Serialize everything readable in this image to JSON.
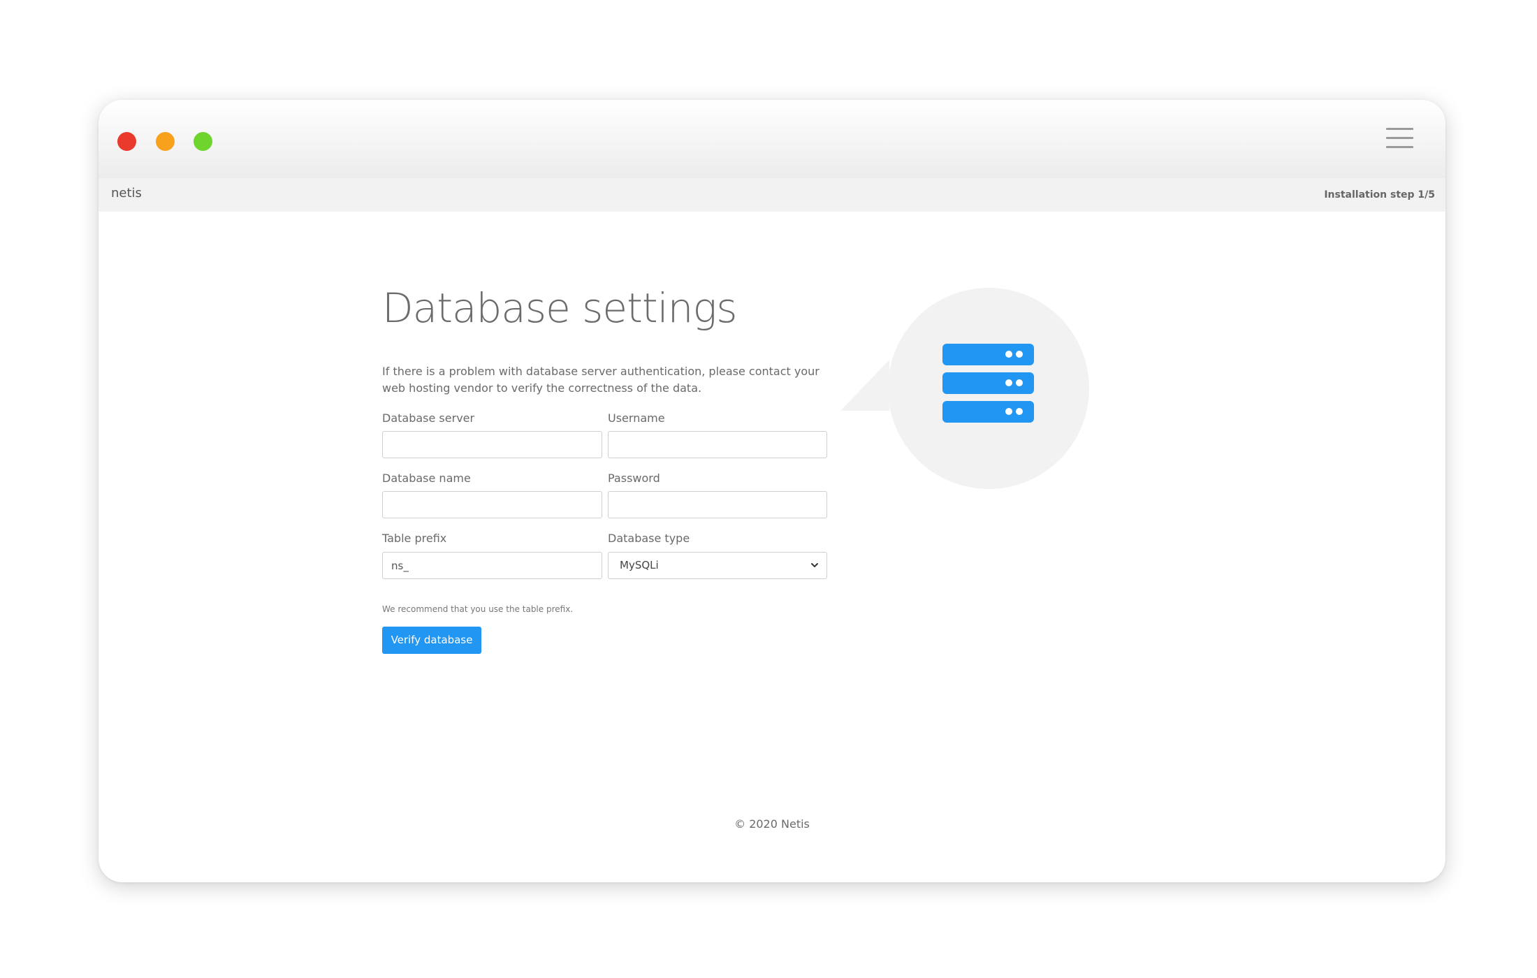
{
  "app": {
    "brand": "netis",
    "step": "Installation step 1/5"
  },
  "page": {
    "title": "Database settings",
    "description": "If there is a problem with database server authentication, please contact your web hosting vendor to verify the correctness of the data."
  },
  "form": {
    "db_server": {
      "label": "Database server",
      "value": ""
    },
    "username": {
      "label": "Username",
      "value": ""
    },
    "db_name": {
      "label": "Database name",
      "value": ""
    },
    "password": {
      "label": "Password",
      "value": ""
    },
    "table_prefix": {
      "label": "Table prefix",
      "value": "ns_",
      "hint": "We recommend that you use the table prefix."
    },
    "db_type": {
      "label": "Database type",
      "selected": "MySQLi"
    },
    "verify_label": "Verify database"
  },
  "footer": {
    "text": "© 2020 Netis"
  },
  "colors": {
    "accent": "#2196f3",
    "close": "#ea3a2e",
    "minimize": "#f8a11d",
    "maximize": "#6fd42d",
    "illustration_bg": "#f2f2f2"
  },
  "icons": {
    "menu": "hamburger-icon",
    "illustration": "database-server-icon",
    "select": "chevron-down-icon"
  }
}
